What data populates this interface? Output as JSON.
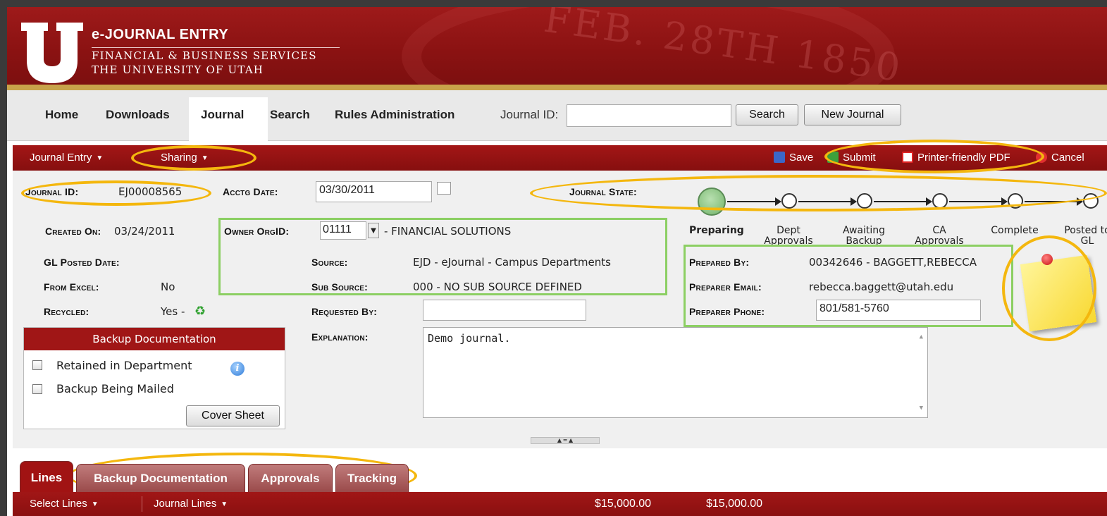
{
  "brand": {
    "title": "e-JOURNAL ENTRY",
    "subtitle1": "FINANCIAL & BUSINESS SERVICES",
    "subtitle2": "THE UNIVERSITY OF UTAH",
    "logo_letter": "U",
    "seal_text": "FEB. 28TH 1850"
  },
  "menu": {
    "items": [
      "Home",
      "Downloads",
      "Journal",
      "Search",
      "Rules Administration"
    ],
    "active": "Journal",
    "journal_id_label": "Journal ID:",
    "journal_id_value": "",
    "search_button": "Search",
    "new_journal_button": "New Journal"
  },
  "toolbar": {
    "journal_entry": "Journal Entry",
    "sharing": "Sharing",
    "save": "Save",
    "submit": "Submit",
    "printer_pdf": "Printer-friendly PDF",
    "cancel": "Cancel"
  },
  "form": {
    "journal_id_label": "Journal ID:",
    "journal_id": "EJ00008565",
    "acctg_date_label": "Acctg Date:",
    "acctg_date": "03/30/2011",
    "created_on_label": "Created On:",
    "created_on": "03/24/2011",
    "gl_posted_label": "GL Posted Date:",
    "gl_posted": "",
    "from_excel_label": "From Excel:",
    "from_excel": "No",
    "recycled_label": "Recycled:",
    "recycled": "Yes -",
    "owner_orgid_label": "Owner OrgID:",
    "owner_orgid": "01111",
    "owner_org_name": "- FINANCIAL SOLUTIONS",
    "source_label": "Source:",
    "source": "EJD - eJournal - Campus Departments",
    "sub_source_label": "Sub Source:",
    "sub_source": "000 - NO SUB SOURCE DEFINED",
    "requested_by_label": "Requested By:",
    "requested_by": "",
    "explanation_label": "Explanation:",
    "explanation": "Demo journal.",
    "prepared_by_label": "Prepared By:",
    "prepared_by": "00342646 - BAGGETT,REBECCA",
    "preparer_email_label": "Preparer Email:",
    "preparer_email": "rebecca.baggett@utah.edu",
    "preparer_phone_label": "Preparer Phone:",
    "preparer_phone": "801/581-5760"
  },
  "journal_state": {
    "label": "Journal State:",
    "states": [
      "Preparing",
      "Dept Approvals",
      "Awaiting Backup",
      "CA Approvals",
      "Complete",
      "Posted to GL"
    ],
    "current": "Preparing"
  },
  "backup": {
    "header": "Backup Documentation",
    "retained": "Retained in Department",
    "mailed": "Backup Being Mailed",
    "retained_checked": false,
    "mailed_checked": false,
    "cover_sheet_button": "Cover Sheet"
  },
  "tabs": [
    "Lines",
    "Backup Documentation",
    "Approvals",
    "Tracking"
  ],
  "active_tab": "Lines",
  "lines_bar": {
    "select_lines": "Select Lines",
    "journal_lines": "Journal Lines",
    "total_debit": "$15,000.00",
    "total_credit": "$15,000.00"
  },
  "colors": {
    "brand_red": "#a11313",
    "highlight_gold": "#f4b70e",
    "highlight_green": "#8ccf63"
  }
}
